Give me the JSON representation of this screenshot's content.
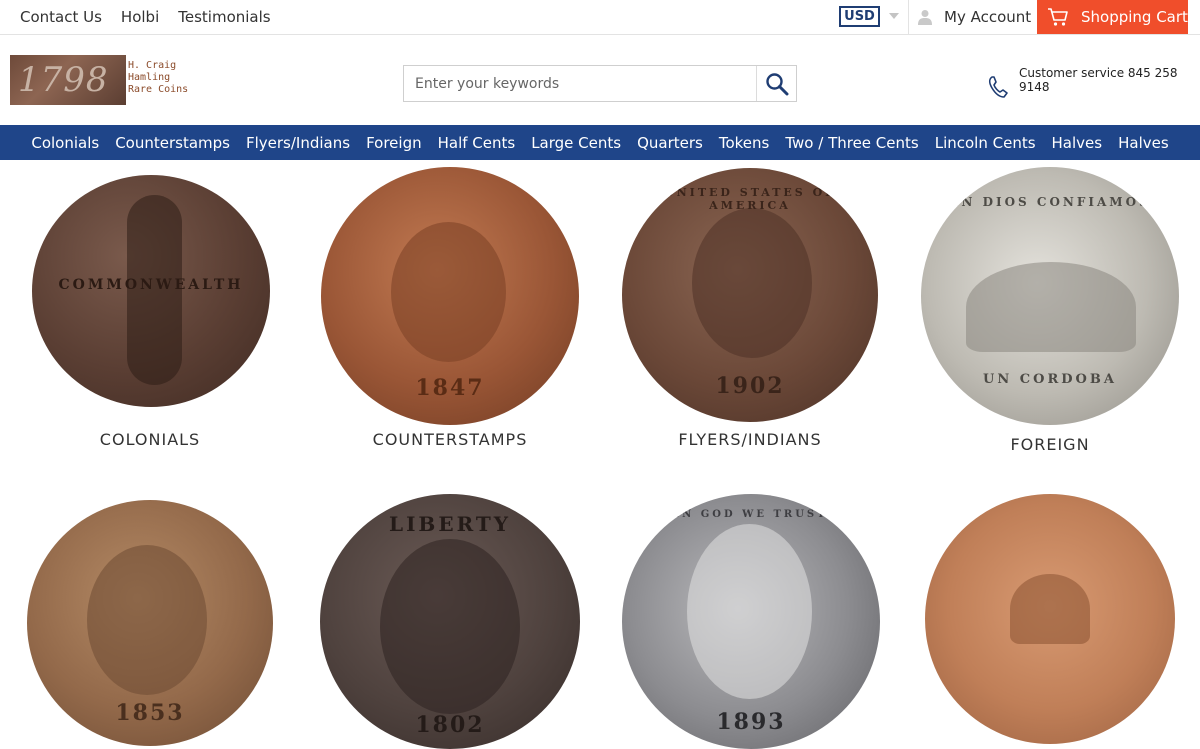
{
  "topbar": {
    "links": [
      "Contact Us",
      "Holbi",
      "Testimonials"
    ],
    "currency": "USD",
    "account_label": "My Account",
    "cart_label": "Shopping Cart"
  },
  "header": {
    "logo_year": "1798",
    "logo_lines": [
      "H. Craig",
      "Hamling",
      "Rare Coins"
    ],
    "search_placeholder": "Enter your keywords",
    "service_text": "Customer service 845 258 9148"
  },
  "nav": [
    "Colonials",
    "Counterstamps",
    "Flyers/Indians",
    "Foreign",
    "Half Cents",
    "Large Cents",
    "Quarters",
    "Tokens",
    "Two / Three Cents",
    "Lincoln Cents",
    "Halves",
    "Halves"
  ],
  "categories": [
    {
      "label": "COLONIALS",
      "legend": "COMMONWEALTH",
      "date": ""
    },
    {
      "label": "COUNTERSTAMPS",
      "legend": "",
      "date": "1847"
    },
    {
      "label": "FLYERS/INDIANS",
      "legend": "UNITED STATES OF AMERICA",
      "date": "1902"
    },
    {
      "label": "FOREIGN",
      "legend": "EN DIOS CONFIAMOS",
      "date": "UN CORDOBA"
    },
    {
      "label": "",
      "legend": "",
      "date": "1853"
    },
    {
      "label": "",
      "legend": "LIBERTY",
      "date": "1802"
    },
    {
      "label": "",
      "legend": "IN GOD WE TRUST",
      "date": "1893"
    },
    {
      "label": "",
      "legend": "",
      "date": ""
    }
  ],
  "colors": {
    "nav_bg": "#1f4589",
    "cart_bg": "#f04e2b",
    "currency_border": "#1f3d73"
  }
}
